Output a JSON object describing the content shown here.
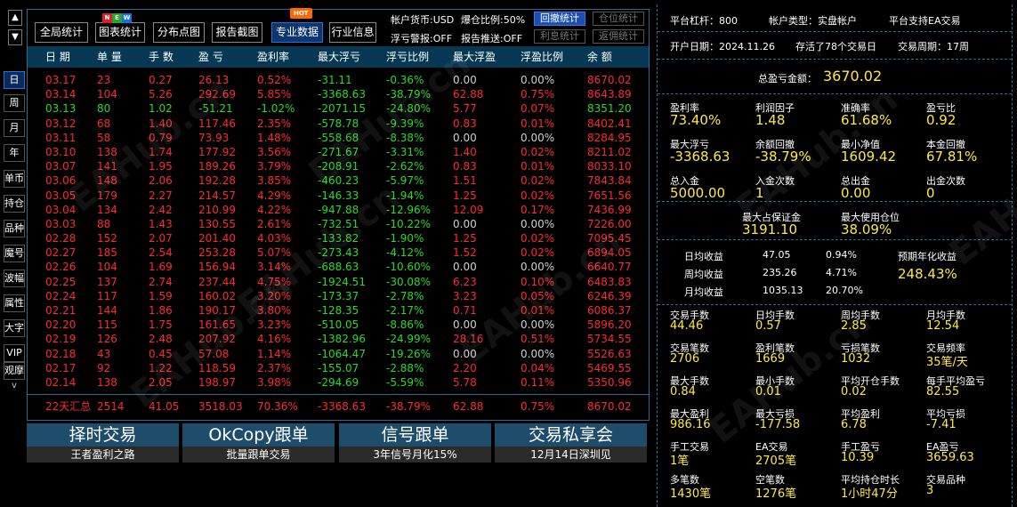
{
  "sidebar": {
    "up_arrow": "▲",
    "down_arrow": "▼",
    "items": [
      "日",
      "周",
      "月",
      "年",
      "单币",
      "持仓",
      "品种",
      "魔号",
      "波幅",
      "属性",
      "大字",
      "VIP",
      "观摩"
    ],
    "more": "v",
    "active_index": 0
  },
  "toolbar": {
    "buttons": [
      "全局统计",
      "图表统计",
      "分布点图",
      "报告截图",
      "专业数据",
      "行业信息"
    ],
    "active_index": 4,
    "new_badge": [
      "N",
      "E",
      "W"
    ],
    "new_badge_colors": [
      "#d9202a",
      "#2aa52a",
      "#1a6fe0"
    ],
    "hot_badge": "HOT",
    "account_currency": "帐户货币:USD",
    "float_warning": "浮亏警报:OFF",
    "margin_ratio": "爆仓比例:50%",
    "report_push": "报告推送:OFF",
    "controls": [
      {
        "label": "回撤统计",
        "state": "on"
      },
      {
        "label": "仓位统计",
        "state": "off"
      },
      {
        "label": "利息统计",
        "state": "off"
      },
      {
        "label": "返佣统计",
        "state": "off"
      }
    ]
  },
  "table": {
    "headers": [
      "日 期",
      "单 量",
      "手 数",
      "盈 亏",
      "盈利率",
      "最大浮亏",
      "浮亏比例",
      "最大浮盈",
      "浮盈比例",
      "余 额"
    ],
    "rows": [
      [
        "03.17",
        "23",
        "0.27",
        "26.13",
        "0.52%",
        "-31.11",
        "-0.36%",
        "0.00",
        "0.00%",
        "8670.02"
      ],
      [
        "03.14",
        "104",
        "5.26",
        "292.69",
        "5.85%",
        "-3368.63",
        "-38.79%",
        "62.88",
        "0.75%",
        "8643.89"
      ],
      [
        "03.13",
        "80",
        "1.02",
        "-51.21",
        "-1.02%",
        "-2071.15",
        "-24.80%",
        "5.77",
        "0.07%",
        "8351.20"
      ],
      [
        "03.12",
        "68",
        "1.40",
        "117.46",
        "2.35%",
        "-578.78",
        "-9.39%",
        "0.83",
        "0.01%",
        "8402.41"
      ],
      [
        "03.11",
        "58",
        "0.79",
        "73.93",
        "1.48%",
        "-558.68",
        "-8.38%",
        "0.00",
        "0.00%",
        "8284.95"
      ],
      [
        "03.10",
        "138",
        "1.74",
        "177.92",
        "3.56%",
        "-271.67",
        "-3.31%",
        "1.40",
        "0.02%",
        "8211.02"
      ],
      [
        "03.07",
        "141",
        "1.95",
        "189.26",
        "3.79%",
        "-208.91",
        "-2.62%",
        "0.83",
        "0.01%",
        "8033.10"
      ],
      [
        "03.06",
        "148",
        "2.06",
        "192.28",
        "3.85%",
        "-460.23",
        "-5.97%",
        "1.51",
        "0.02%",
        "7843.84"
      ],
      [
        "03.05",
        "179",
        "2.27",
        "214.57",
        "4.29%",
        "-146.33",
        "-1.94%",
        "1.25",
        "0.02%",
        "7651.56"
      ],
      [
        "03.04",
        "134",
        "2.42",
        "210.99",
        "4.22%",
        "-947.88",
        "-12.96%",
        "12.09",
        "0.17%",
        "7436.99"
      ],
      [
        "03.03",
        "88",
        "1.43",
        "130.55",
        "2.61%",
        "-732.51",
        "-10.22%",
        "0.00",
        "0.00%",
        "7226.00"
      ],
      [
        "02.28",
        "152",
        "2.07",
        "201.40",
        "4.03%",
        "-133.82",
        "-1.90%",
        "1.25",
        "0.02%",
        "7095.45"
      ],
      [
        "02.27",
        "185",
        "2.54",
        "253.28",
        "5.07%",
        "-273.43",
        "-4.12%",
        "1.52",
        "0.02%",
        "6894.05"
      ],
      [
        "02.26",
        "104",
        "1.69",
        "156.94",
        "3.14%",
        "-688.63",
        "-10.60%",
        "0.00",
        "0.00%",
        "6640.77"
      ],
      [
        "02.25",
        "137",
        "2.74",
        "237.44",
        "4.75%",
        "-1924.51",
        "-30.08%",
        "6.23",
        "0.10%",
        "6483.83"
      ],
      [
        "02.24",
        "117",
        "1.59",
        "160.02",
        "3.20%",
        "-173.37",
        "-2.78%",
        "3.23",
        "0.05%",
        "6246.39"
      ],
      [
        "02.21",
        "144",
        "1.86",
        "190.17",
        "3.80%",
        "-128.35",
        "-2.17%",
        "0.71",
        "0.01%",
        "6086.37"
      ],
      [
        "02.20",
        "115",
        "1.75",
        "161.65",
        "3.23%",
        "-510.05",
        "-8.86%",
        "0.00",
        "0.00%",
        "5896.20"
      ],
      [
        "02.19",
        "126",
        "2.48",
        "207.92",
        "4.16%",
        "-1382.96",
        "-24.99%",
        "28.16",
        "0.51%",
        "5734.55"
      ],
      [
        "02.18",
        "43",
        "0.45",
        "57.08",
        "1.14%",
        "-1064.47",
        "-19.26%",
        "0.00",
        "0.00%",
        "5526.63"
      ],
      [
        "02.17",
        "92",
        "1.22",
        "118.59",
        "2.37%",
        "-155.07",
        "-2.88%",
        "2.20",
        "0.04%",
        "5469.55"
      ],
      [
        "02.14",
        "138",
        "2.05",
        "198.97",
        "3.98%",
        "-294.69",
        "-5.59%",
        "5.78",
        "0.11%",
        "5350.96"
      ]
    ],
    "summary": [
      "22天汇总",
      "2514",
      "41.05",
      "3518.03",
      "70.36%",
      "-3368.63",
      "-38.79%",
      "62.88",
      "0.75%",
      "8670.02"
    ]
  },
  "promos": [
    {
      "title": "择时交易",
      "subtitle": "王者盈利之路"
    },
    {
      "title": "OkCopy跟单",
      "subtitle": "批量跟单交易"
    },
    {
      "title": "信号跟单",
      "subtitle": "3年信号月化15%"
    },
    {
      "title": "交易私享会",
      "subtitle": "12月14日深圳见"
    }
  ],
  "stats": {
    "platform_leverage": "平台杠杆：800",
    "account_type": "帐户类型：实盘帐户",
    "ea_support": "平台支持EA交易",
    "open_date": "开户日期：2024.11.26",
    "days_traded": "存活了78个交易日",
    "trade_cycle": "交易周期：17周",
    "total_pnl_label": "总盈亏金额：",
    "total_pnl_value": "3670.02",
    "grid1": [
      {
        "label": "盈利率",
        "value": "73.40%"
      },
      {
        "label": "利润因子",
        "value": "1.48"
      },
      {
        "label": "准确率",
        "value": "61.68%"
      },
      {
        "label": "盈亏比",
        "value": "0.92"
      },
      {
        "label": "最大浮亏",
        "value": "-3368.63"
      },
      {
        "label": "余额回撤",
        "value": "-38.79%"
      },
      {
        "label": "最小净值",
        "value": "1609.42"
      },
      {
        "label": "本金回撤",
        "value": "67.81%"
      },
      {
        "label": "总入金",
        "value": "5000.00"
      },
      {
        "label": "入金次数",
        "value": "1"
      },
      {
        "label": "总出金",
        "value": "0.00"
      },
      {
        "label": "出金次数",
        "value": "0"
      }
    ],
    "max_margin_label": "最大占保证金",
    "max_margin_value": "3191.10",
    "max_position_label": "最大使用仓位",
    "max_position_value": "38.09%",
    "avg_returns": [
      {
        "label": "日均收益",
        "amount": "47.05",
        "percent": "0.94%"
      },
      {
        "label": "周均收益",
        "amount": "235.26",
        "percent": "4.71%"
      },
      {
        "label": "月均收益",
        "amount": "1035.13",
        "percent": "20.70%"
      }
    ],
    "annual_label": "预期年化收益",
    "annual_value": "248.43%",
    "grid2": [
      {
        "label": "交易手数",
        "value": "44.46"
      },
      {
        "label": "日均手数",
        "value": "0.57"
      },
      {
        "label": "周均手数",
        "value": "2.85"
      },
      {
        "label": "月均手数",
        "value": "12.54"
      },
      {
        "label": "交易笔数",
        "value": "2706"
      },
      {
        "label": "盈利笔数",
        "value": "1669"
      },
      {
        "label": "亏损笔数",
        "value": "1032"
      },
      {
        "label": "交易频率",
        "value": "35笔/天"
      },
      {
        "label": "最大手数",
        "value": "0.84"
      },
      {
        "label": "最小手数",
        "value": "0.01"
      },
      {
        "label": "平均开仓手数",
        "value": "0.02"
      },
      {
        "label": "每手平均盈亏",
        "value": "82.55"
      },
      {
        "label": "最大盈利",
        "value": "986.16"
      },
      {
        "label": "最大亏损",
        "value": "-177.58"
      },
      {
        "label": "平均盈利",
        "value": "6.78"
      },
      {
        "label": "平均亏损",
        "value": "-7.41"
      },
      {
        "label": "手工交易",
        "value": "1笔"
      },
      {
        "label": "EA交易",
        "value": "2705笔"
      },
      {
        "label": "手工盈亏",
        "value": "10.39"
      },
      {
        "label": "EA盈亏",
        "value": "3659.63"
      },
      {
        "label": "多笔数",
        "value": "1430笔"
      },
      {
        "label": "空笔数",
        "value": "1276笔"
      },
      {
        "label": "平均持仓时长",
        "value": "1小时47分"
      },
      {
        "label": "交易品种",
        "value": "3"
      }
    ]
  },
  "watermark": "EAHub.cn",
  "colors": {
    "profit": "#ff2a2a",
    "loss": "#2bd92b",
    "neutral": "#cfcfcf",
    "stat_value": "#ffe84a",
    "header_bg": "#063753",
    "border": "#2f6b8f"
  }
}
